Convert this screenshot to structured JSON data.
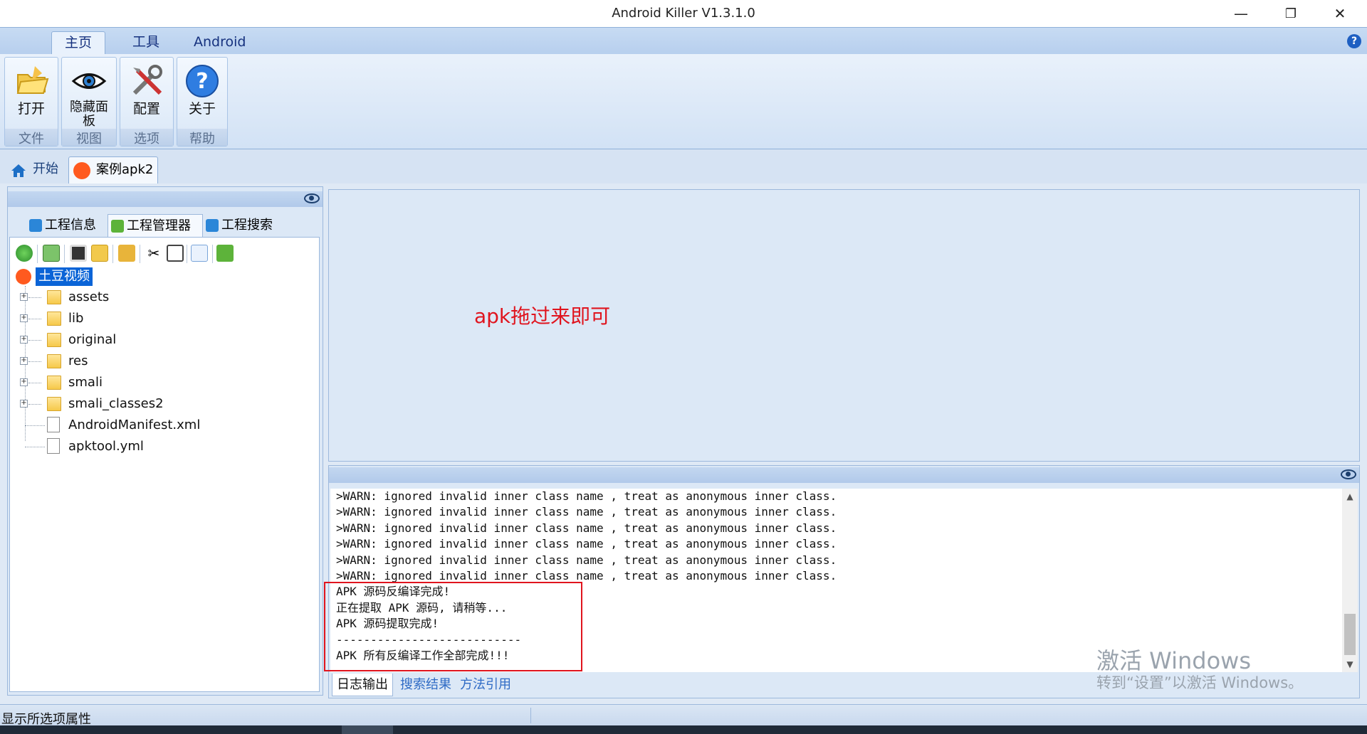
{
  "window": {
    "title": "Android Killer V1.3.1.0",
    "minimize": "—",
    "restore": "❐",
    "close": "✕"
  },
  "ribbon": {
    "tabs": [
      "主页",
      "工具",
      "Android"
    ],
    "groups": [
      {
        "button": "打开",
        "group": "文件",
        "icon": "open-folder-icon"
      },
      {
        "button": "隐藏面板",
        "group": "视图",
        "icon": "eye-icon"
      },
      {
        "button": "配置",
        "group": "选项",
        "icon": "tools-icon"
      },
      {
        "button": "关于",
        "group": "帮助",
        "icon": "help-icon"
      }
    ],
    "help_glyph": "?"
  },
  "doc_tabs": [
    "开始",
    "案例apk2"
  ],
  "left_panel": {
    "tabs": [
      "工程信息",
      "工程管理器",
      "工程搜索"
    ],
    "toolbar_icons": [
      "refresh-icon",
      "export-icon",
      "stop-icon",
      "find-icon",
      "open-folder-icon",
      "cut-icon",
      "rename-icon",
      "pdf-icon",
      "android-icon"
    ],
    "root": "土豆视频",
    "tree": [
      {
        "name": "assets",
        "type": "folder"
      },
      {
        "name": "lib",
        "type": "folder"
      },
      {
        "name": "original",
        "type": "folder"
      },
      {
        "name": "res",
        "type": "folder"
      },
      {
        "name": "smali",
        "type": "folder"
      },
      {
        "name": "smali_classes2",
        "type": "folder"
      },
      {
        "name": "AndroidManifest.xml",
        "type": "file"
      },
      {
        "name": "apktool.yml",
        "type": "file"
      }
    ]
  },
  "drop_area": {
    "hint": "apk拖过来即可"
  },
  "log": {
    "lines": [
      ">WARN: ignored invalid inner class name , treat as anonymous inner class.",
      ">WARN: ignored invalid inner class name , treat as anonymous inner class.",
      ">WARN: ignored invalid inner class name , treat as anonymous inner class.",
      ">WARN: ignored invalid inner class name , treat as anonymous inner class.",
      ">WARN: ignored invalid inner class name , treat as anonymous inner class.",
      ">WARN: ignored invalid inner class name , treat as anonymous inner class.",
      "APK 源码反编译完成!",
      "正在提取 APK 源码, 请稍等...",
      "APK 源码提取完成!",
      "---------------------------",
      "APK 所有反编译工作全部完成!!!"
    ],
    "tabs": [
      "日志输出",
      "搜索结果",
      "方法引用"
    ]
  },
  "watermark": {
    "line1": "激活 Windows",
    "line2": "转到“设置”以激活 Windows。"
  },
  "status": {
    "text": "显示所选项属性"
  }
}
